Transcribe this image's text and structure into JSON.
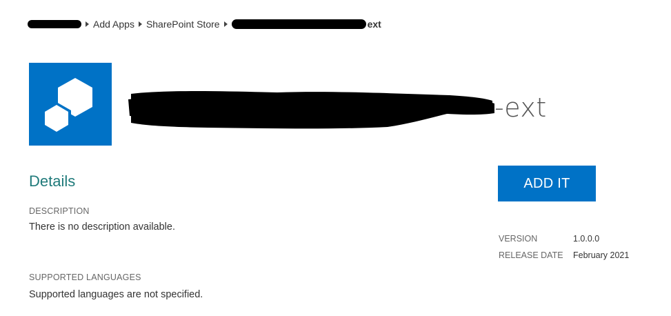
{
  "breadcrumb": {
    "items": [
      "Add Apps",
      "SharePoint Store"
    ],
    "current_visible_suffix": "ext"
  },
  "app": {
    "title_visible_suffix": "-ext",
    "tile_color": "#0072c6",
    "icon": "app-cube-icon"
  },
  "details": {
    "heading": "Details",
    "description_label": "DESCRIPTION",
    "description_value": "There is no description available.",
    "languages_label": "SUPPORTED LANGUAGES",
    "languages_value": "Supported languages are not specified."
  },
  "actions": {
    "add_label": "ADD IT",
    "accent": "#0072c6"
  },
  "meta": {
    "version_label": "VERSION",
    "version_value": "1.0.0.0",
    "release_label": "RELEASE DATE",
    "release_value": "February 2021"
  }
}
